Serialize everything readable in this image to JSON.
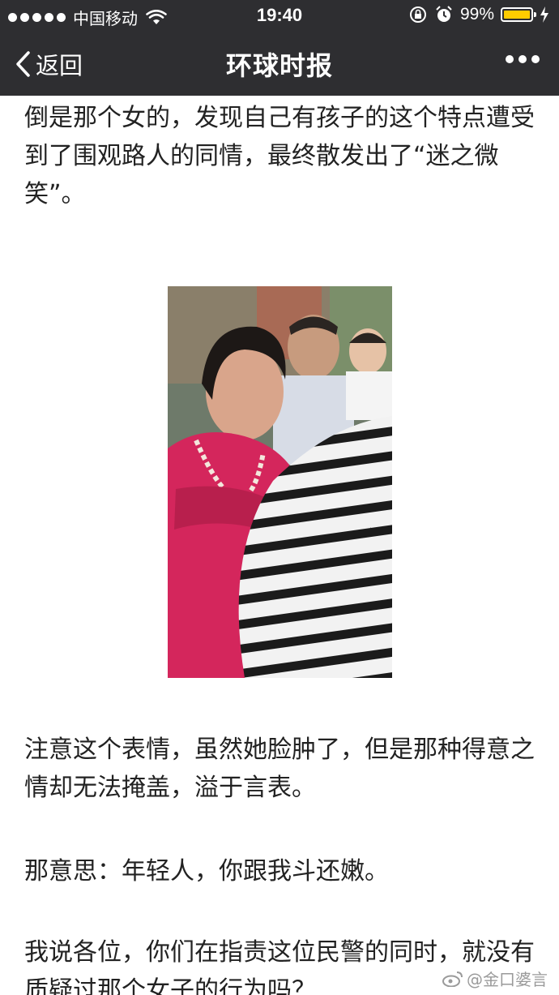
{
  "status_bar": {
    "carrier": "中国移动",
    "time": "19:40",
    "battery": "99%",
    "battery_level": 0.99
  },
  "nav": {
    "back_label": "返回",
    "title": "环球时报"
  },
  "article": {
    "paragraphs": [
      "倒是那个女的，发现自己有孩子的这个特点遭受到了围观路人的同情，最终散发出了“迷之微笑”。",
      "注意这个表情，虽然她脸肿了，但是那种得意之情却无法掩盖，溢于言表。",
      "那意思：年轻人，你跟我斗还嫩。",
      "我说各位，你们在指责这位民警的同时，就没有质疑过那个女子的行为吗？"
    ]
  },
  "watermark": "@金口婆言",
  "colors": {
    "bar_bg": "#2e2e31",
    "battery": "#ffcc00",
    "text": "#222222"
  }
}
